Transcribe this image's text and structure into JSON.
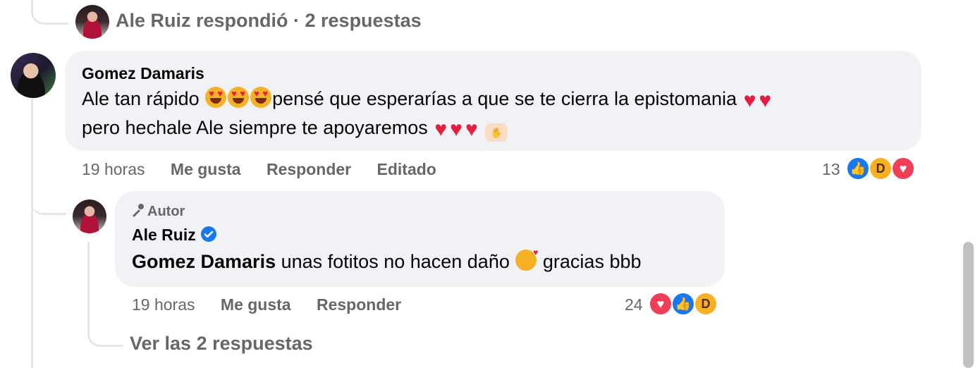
{
  "top_reply": {
    "text": "Ale Ruiz respondió · 2 respuestas"
  },
  "comment1": {
    "author": "Gomez Damaris",
    "text_part1": "Ale tan rápido",
    "text_part2": "pensé que esperarías a que se te cierra la epistomania",
    "text_part3": "pero hechale Ale siempre te apoyaremos",
    "time": "19 horas",
    "like_label": "Me gusta",
    "reply_label": "Responder",
    "edited_label": "Editado",
    "reaction_count": "13",
    "reactions": [
      "like-icon",
      "haha-icon",
      "love-icon"
    ]
  },
  "comment2": {
    "badge": "Autor",
    "author": "Ale Ruiz",
    "verified": true,
    "mention": "Gomez Damaris",
    "text_part1": "unas fotitos no hacen daño",
    "text_part2": "gracias bbb",
    "time": "19 horas",
    "like_label": "Me gusta",
    "reply_label": "Responder",
    "reaction_count": "24",
    "reactions": [
      "love-icon",
      "like-icon",
      "haha-icon"
    ]
  },
  "view_replies": {
    "label": "Ver las 2 respuestas"
  },
  "colors": {
    "bubble": "#f0f2f5",
    "secondary_text": "#65676b",
    "like_blue": "#1877f2",
    "love_red": "#f33e58",
    "heart_red": "#e41e3f"
  }
}
